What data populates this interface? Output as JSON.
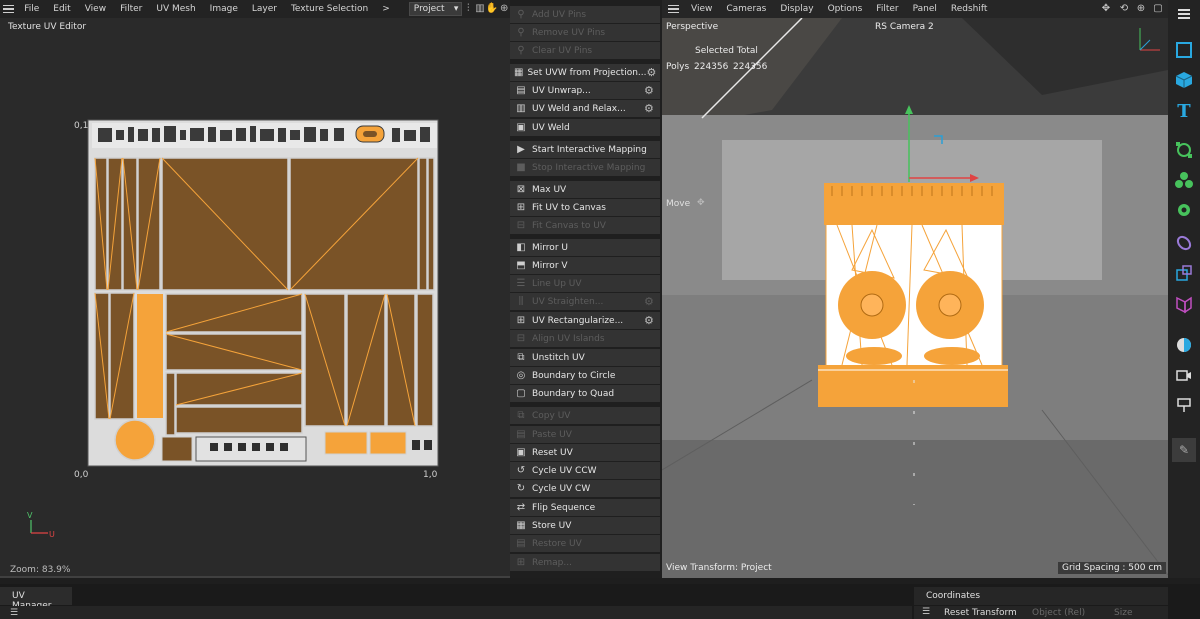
{
  "uv_editor": {
    "menu": [
      "File",
      "Edit",
      "View",
      "Filter",
      "UV Mesh",
      "Image",
      "Layer",
      "Texture Selection"
    ],
    "more_arrow": ">",
    "mode_select": "Project",
    "title": "Texture UV Editor",
    "axis_labels": {
      "origin": "0,0",
      "top": "0,1",
      "right": "1,0",
      "v": "V",
      "u": "U"
    },
    "zoom": "Zoom: 83.9%"
  },
  "commands": [
    {
      "label": "Add UV Pins",
      "enabled": false,
      "gear": false,
      "icon": "pin-icon"
    },
    {
      "label": "Remove UV Pins",
      "enabled": false,
      "gear": false,
      "icon": "pin-remove-icon"
    },
    {
      "label": "Clear UV Pins",
      "enabled": false,
      "gear": false,
      "icon": "pin-clear-icon"
    },
    {
      "label": "Set UVW from Projection...",
      "enabled": true,
      "gear": true,
      "icon": "projection-icon"
    },
    {
      "label": "UV Unwrap...",
      "enabled": true,
      "gear": true,
      "icon": "unwrap-icon"
    },
    {
      "label": "UV Weld and Relax...",
      "enabled": true,
      "gear": true,
      "icon": "weld-relax-icon"
    },
    {
      "label": "UV Weld",
      "enabled": true,
      "gear": false,
      "icon": "weld-icon"
    },
    {
      "label": "Start Interactive Mapping",
      "enabled": true,
      "gear": false,
      "icon": "play-icon"
    },
    {
      "label": "Stop Interactive Mapping",
      "enabled": false,
      "gear": false,
      "icon": "stop-icon"
    },
    {
      "label": "Max UV",
      "enabled": true,
      "gear": false,
      "icon": "max-uv-icon"
    },
    {
      "label": "Fit UV to Canvas",
      "enabled": true,
      "gear": false,
      "icon": "fit-canvas-icon"
    },
    {
      "label": "Fit Canvas to UV",
      "enabled": false,
      "gear": false,
      "icon": "fit-uv-icon"
    },
    {
      "label": "Mirror U",
      "enabled": true,
      "gear": false,
      "icon": "mirror-u-icon"
    },
    {
      "label": "Mirror V",
      "enabled": true,
      "gear": false,
      "icon": "mirror-v-icon"
    },
    {
      "label": "Line Up UV",
      "enabled": false,
      "gear": false,
      "icon": "line-up-icon"
    },
    {
      "label": "UV Straighten...",
      "enabled": false,
      "gear": true,
      "icon": "straighten-icon"
    },
    {
      "label": "UV Rectangularize...",
      "enabled": true,
      "gear": true,
      "icon": "rectangularize-icon"
    },
    {
      "label": "Align UV Islands",
      "enabled": false,
      "gear": false,
      "icon": "align-icon"
    },
    {
      "label": "Unstitch UV",
      "enabled": true,
      "gear": false,
      "icon": "unstitch-icon"
    },
    {
      "label": "Boundary to Circle",
      "enabled": true,
      "gear": false,
      "icon": "circle-icon"
    },
    {
      "label": "Boundary to Quad",
      "enabled": true,
      "gear": false,
      "icon": "quad-icon"
    },
    {
      "label": "Copy UV",
      "enabled": false,
      "gear": false,
      "icon": "copy-icon"
    },
    {
      "label": "Paste UV",
      "enabled": false,
      "gear": false,
      "icon": "paste-icon"
    },
    {
      "label": "Reset UV",
      "enabled": true,
      "gear": false,
      "icon": "reset-icon"
    },
    {
      "label": "Cycle UV CCW",
      "enabled": true,
      "gear": false,
      "icon": "cycle-ccw-icon"
    },
    {
      "label": "Cycle UV CW",
      "enabled": true,
      "gear": false,
      "icon": "cycle-cw-icon"
    },
    {
      "label": "Flip Sequence",
      "enabled": true,
      "gear": false,
      "icon": "flip-icon"
    },
    {
      "label": "Store UV",
      "enabled": true,
      "gear": false,
      "icon": "store-icon"
    },
    {
      "label": "Restore UV",
      "enabled": false,
      "gear": false,
      "icon": "restore-icon"
    },
    {
      "label": "Remap...",
      "enabled": false,
      "gear": false,
      "icon": "remap-icon"
    }
  ],
  "viewport": {
    "menu": [
      "View",
      "Cameras",
      "Display",
      "Options",
      "Filter",
      "Panel",
      "Redshift"
    ],
    "camera_name": "Perspective",
    "render_camera": "RS Camera 2",
    "stats_selected_label": "Selected Total",
    "stats_row_label": "Polys",
    "stats_selected": "224356",
    "stats_total": "224356",
    "tool_label": "Move",
    "view_transform": "View Transform: Project",
    "grid_spacing": "Grid Spacing : 500 cm"
  },
  "bottom": {
    "uv_manager_tab": "UV Manager",
    "coordinates_tab": "Coordinates",
    "reset_transform": "Reset Transform",
    "object_mode": "Object (Rel)",
    "size_label": "Size"
  },
  "colors": {
    "accent_orange": "#f5a33a",
    "uv_fill": "#7a5327",
    "highlight_blue": "#2a9fd6"
  }
}
